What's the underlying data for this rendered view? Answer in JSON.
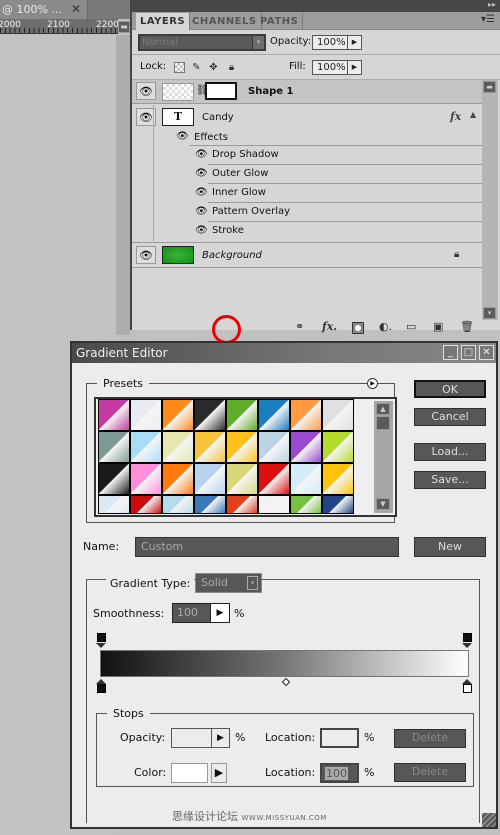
{
  "document": {
    "tab_title": "@ 100% ...",
    "ruler_labels": [
      "2000",
      "2100",
      "2200"
    ]
  },
  "layers_panel": {
    "tabs": [
      {
        "label": "LAYERS",
        "active": true
      },
      {
        "label": "CHANNELS",
        "active": false
      },
      {
        "label": "PATHS",
        "active": false
      }
    ],
    "blend_mode": "Normal",
    "opacity_label": "Opacity:",
    "opacity_value": "100%",
    "lock_label": "Lock:",
    "fill_label": "Fill:",
    "fill_value": "100%",
    "layers": [
      {
        "name": "Shape 1",
        "type": "shape",
        "visible": true,
        "selected": true
      },
      {
        "name": "Candy",
        "type": "text",
        "visible": true,
        "thumb_glyph": "T",
        "has_fx": true,
        "effects_label": "Effects",
        "effects": [
          "Drop Shadow",
          "Outer Glow",
          "Inner Glow",
          "Pattern Overlay",
          "Stroke"
        ]
      },
      {
        "name": "Background",
        "type": "background",
        "visible": true,
        "locked": true,
        "thumb_color": "#1a9a1a"
      }
    ],
    "bottom_icons": [
      "link-layers-icon",
      "fx-icon",
      "add-mask-icon",
      "adjustment-layer-icon",
      "new-group-icon",
      "new-layer-icon",
      "delete-layer-icon"
    ],
    "highlighted_icon": "add-mask-icon",
    "highlight_color": "#e00000"
  },
  "gradient_editor": {
    "title": "Gradient Editor",
    "presets_label": "Presets",
    "preset_swatches": [
      [
        "#c43aa0",
        "#e8ecf2",
        "#ff8a1a",
        "#2a2a2a",
        "#5fae2a",
        "#1a7fc0",
        "#ff9a40",
        "#e0e0e0"
      ],
      [
        "#7f9a94",
        "#a8def5",
        "#e6e8b0",
        "#f5c23a",
        "#ffc21a",
        "#bcd4e4",
        "#9a4ad0",
        "#b4dc2a"
      ],
      [
        "#1a1a1a",
        "#ff90d8",
        "#ff7a0a",
        "#b8d4ee",
        "#d8d87a",
        "#dc1010",
        "#d4ecf8",
        "#ffc20a"
      ],
      [
        "#dce8f4",
        "#cc0c0c",
        "#b4dcea",
        "#3a7ab8",
        "#e0401a",
        "#f2f2f2",
        "#7ac040",
        "#224488"
      ]
    ],
    "buttons": {
      "ok": "OK",
      "cancel": "Cancel",
      "load": "Load...",
      "save": "Save...",
      "new": "New"
    },
    "name_label": "Name:",
    "name_value": "Custom",
    "gradient_type_label": "Gradient Type:",
    "gradient_type_value": "Solid",
    "smoothness_label": "Smoothness:",
    "smoothness_value": "100",
    "percent": "%",
    "gradient": {
      "color_stops": [
        {
          "location": 0,
          "color": "#111111"
        },
        {
          "location": 100,
          "color": "#ffffff",
          "selected": true
        }
      ],
      "opacity_stops": [
        {
          "location": 0,
          "opacity": 100
        },
        {
          "location": 100,
          "opacity": 100
        }
      ],
      "midpoint": 50
    },
    "stops": {
      "legend": "Stops",
      "opacity_label": "Opacity:",
      "opacity_value": "",
      "location_label": "Location:",
      "opacity_location_value": "",
      "color_label": "Color:",
      "color_value": "#ffffff",
      "color_location_value": "100",
      "delete_label": "Delete"
    },
    "watermark_cn": "思缘设计论坛",
    "watermark_url": "WWW.MISSYUAN.COM"
  }
}
